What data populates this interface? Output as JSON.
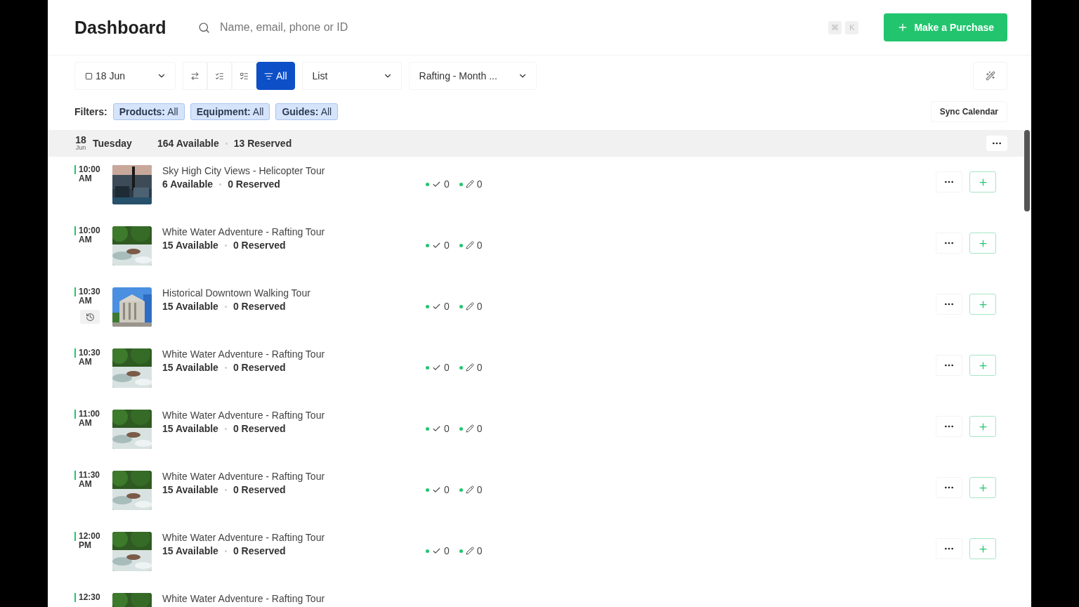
{
  "header": {
    "title": "Dashboard",
    "search": {
      "placeholder": "Name, email, phone or ID"
    },
    "shortcut_keys": [
      "⌘",
      "K"
    ],
    "purchase_button": "Make a Purchase"
  },
  "toolbar": {
    "date": "18 Jun",
    "view_modes": [
      {
        "kind": "toggle",
        "selected": false
      },
      {
        "kind": "list-a",
        "selected": false
      },
      {
        "kind": "list-b",
        "selected": false
      },
      {
        "kind": "all",
        "label": "All",
        "selected": true
      }
    ],
    "layout": "List",
    "calendar": "Rafting - Month ..."
  },
  "filters": {
    "label": "Filters:",
    "chips": [
      {
        "name": "Products:",
        "value": "All"
      },
      {
        "name": "Equipment:",
        "value": "All"
      },
      {
        "name": "Guides:",
        "value": "All"
      }
    ],
    "sync_button": "Sync Calendar"
  },
  "day": {
    "day": "18",
    "month": "Jun",
    "weekday": "Tuesday",
    "available": "164 Available",
    "reserved": "13 Reserved"
  },
  "rows": [
    {
      "time": "10:00",
      "period": "AM",
      "title": "Sky High City Views - Helicopter Tour",
      "available": "6 Available",
      "reserved": "0 Reserved",
      "checked": "0",
      "edited": "0",
      "history": false
    },
    {
      "time": "10:00",
      "period": "AM",
      "title": "White Water Adventure - Rafting Tour",
      "available": "15 Available",
      "reserved": "0 Reserved",
      "checked": "0",
      "edited": "0",
      "history": false
    },
    {
      "time": "10:30",
      "period": "AM",
      "title": "Historical Downtown Walking Tour",
      "available": "15 Available",
      "reserved": "0 Reserved",
      "checked": "0",
      "edited": "0",
      "history": true
    },
    {
      "time": "10:30",
      "period": "AM",
      "title": "White Water Adventure - Rafting Tour",
      "available": "15 Available",
      "reserved": "0 Reserved",
      "checked": "0",
      "edited": "0",
      "history": false
    },
    {
      "time": "11:00",
      "period": "AM",
      "title": "White Water Adventure - Rafting Tour",
      "available": "15 Available",
      "reserved": "0 Reserved",
      "checked": "0",
      "edited": "0",
      "history": false
    },
    {
      "time": "11:30",
      "period": "AM",
      "title": "White Water Adventure - Rafting Tour",
      "available": "15 Available",
      "reserved": "0 Reserved",
      "checked": "0",
      "edited": "0",
      "history": false
    },
    {
      "time": "12:00",
      "period": "PM",
      "title": "White Water Adventure - Rafting Tour",
      "available": "15 Available",
      "reserved": "0 Reserved",
      "checked": "0",
      "edited": "0",
      "history": false
    },
    {
      "time": "12:30",
      "title": "White Water Adventure - Rafting Tour"
    }
  ]
}
